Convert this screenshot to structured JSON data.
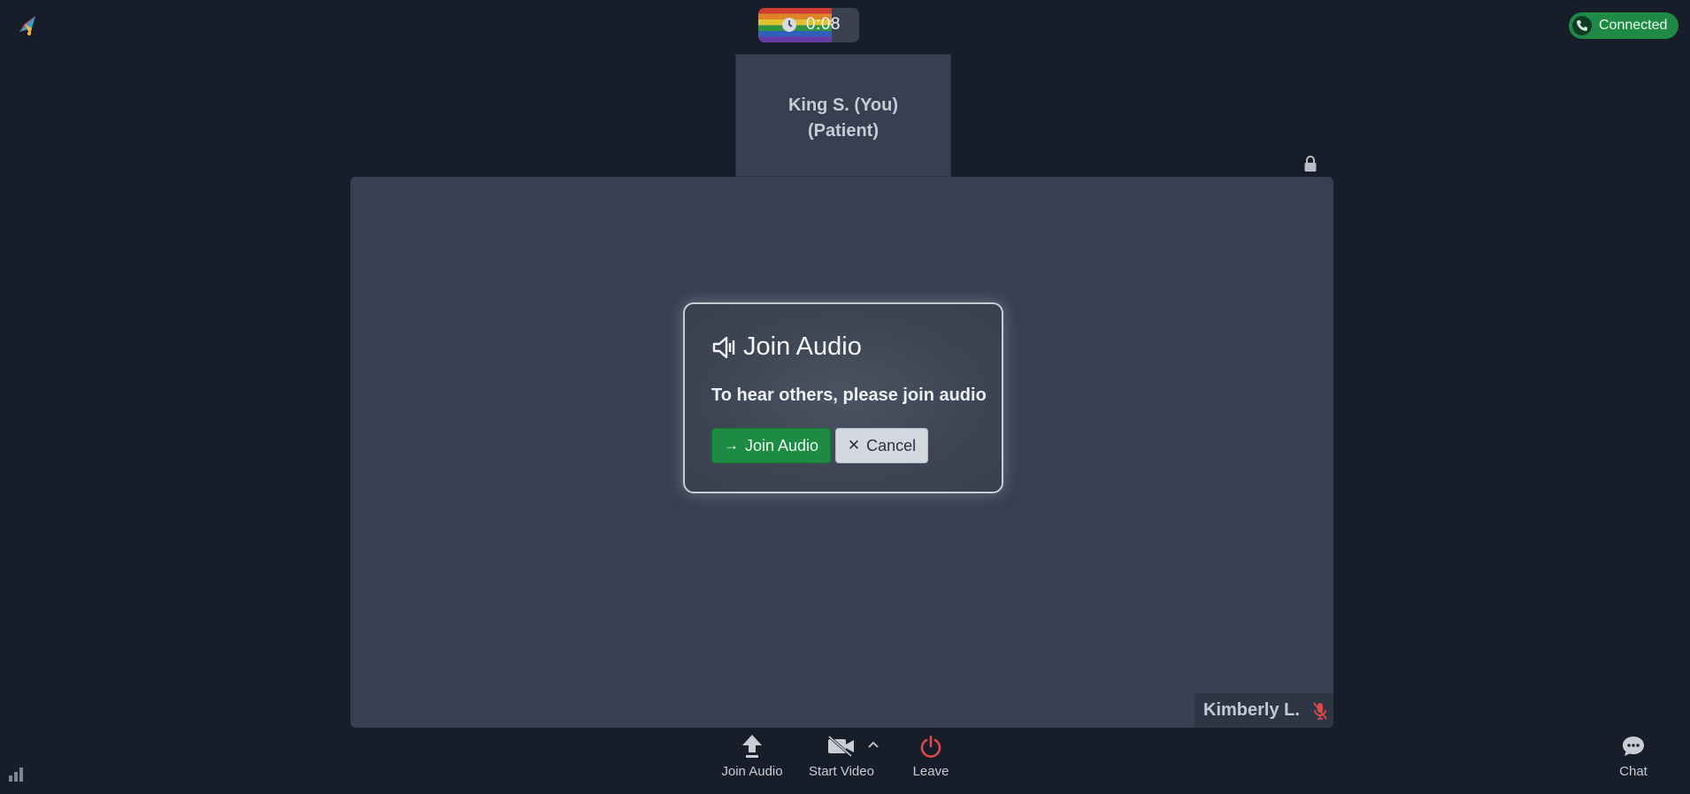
{
  "header": {
    "logo_icon": "brand-logo-icon",
    "timer": {
      "icon": "clock-icon",
      "time": "0:08"
    },
    "status": {
      "icon": "phone-icon",
      "label": "Connected",
      "color": "#1f8a45"
    }
  },
  "self_tile": {
    "name_line1": "King S. (You)",
    "name_line2": "(Patient)"
  },
  "stage": {
    "lock_icon": "lock-icon",
    "participant": {
      "name": "Kimberly L.",
      "mic_icon": "mic-muted-icon",
      "mic_color": "#d94a4a"
    }
  },
  "modal": {
    "icon": "speaker-icon",
    "title": "Join Audio",
    "message": "To hear others, please join audio",
    "join_label": "Join Audio",
    "join_glyph": "→",
    "cancel_label": "Cancel",
    "cancel_glyph": "✕",
    "accent": "#1e8b43"
  },
  "toolbar": {
    "join_audio_label": "Join Audio",
    "start_video_label": "Start Video",
    "leave_label": "Leave",
    "leave_color": "#d94a4a",
    "chat_label": "Chat"
  },
  "footer": {
    "signal_icon": "signal-bars-icon"
  }
}
